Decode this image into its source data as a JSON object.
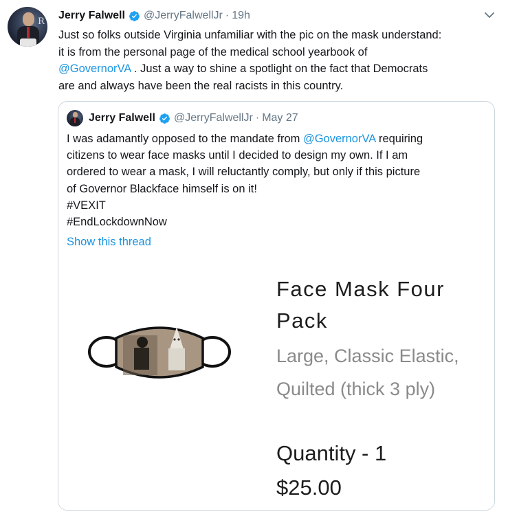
{
  "tweet": {
    "author_name": "Jerry Falwell",
    "handle": "@JerryFalwellJr",
    "separator": "·",
    "time": "19h",
    "body_part1": "Just so folks outside Virginia unfamiliar with the pic on the mask understand:\nit is from the personal page of the medical school yearbook of\n",
    "body_mention": "@GovernorVA",
    "body_part2": " . Just a way to shine a spotlight on the fact that Democrats\nare and always have been the real racists in this country."
  },
  "quoted_tweet": {
    "author_name": "Jerry Falwell",
    "handle": "@JerryFalwellJr",
    "separator": "·",
    "date": "May 27",
    "body_part1": "I was adamantly opposed to the mandate from ",
    "body_mention": "@GovernorVA",
    "body_part2": " requiring\ncitizens to wear face masks until I decided to design my own. If I am\nordered to wear a mask, I will reluctantly comply, but only if this picture\nof Governor Blackface himself is on it!\n#VEXIT\n#EndLockdownNow",
    "show_thread": "Show this thread"
  },
  "product": {
    "title": "Face Mask Four Pack",
    "variant": "Large, Classic Elastic, Quilted (thick 3 ply)",
    "quantity": "Quantity - 1",
    "price": "$25.00"
  },
  "colors": {
    "link": "#1b95e0",
    "secondary_text": "#657786",
    "verified": "#1da1f2",
    "border": "#ccd6dd"
  },
  "icons": {
    "verified": "verified-badge-icon",
    "caret": "chevron-down-icon"
  }
}
